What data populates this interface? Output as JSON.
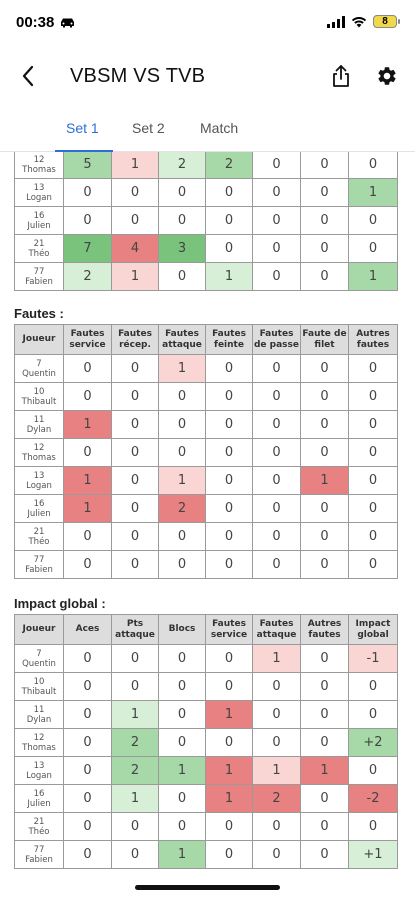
{
  "status_bar": {
    "time": "00:38",
    "battery": "8"
  },
  "header": {
    "title": "VBSM VS TVB"
  },
  "tabs": [
    {
      "label": "Set 1",
      "active": true
    },
    {
      "label": "Set 2",
      "active": false
    },
    {
      "label": "Match",
      "active": false
    }
  ],
  "colors": {
    "accent": "#2d6fd8",
    "green_dark": "#79c37d",
    "green_mid": "#a7d9a8",
    "green_light": "#d7efd6",
    "red_dark": "#e88282",
    "red_mid": "#f1a8a6",
    "red_light": "#f9d5d3",
    "header_bg": "#dddddd"
  },
  "top_table": {
    "rows": [
      {
        "num": "12",
        "name": "Thomas",
        "cells": [
          {
            "v": "5",
            "c": "g2"
          },
          {
            "v": "1",
            "c": "r1"
          },
          {
            "v": "2",
            "c": "g1"
          },
          {
            "v": "2",
            "c": "g2"
          },
          {
            "v": "0"
          },
          {
            "v": "0"
          },
          {
            "v": "0"
          }
        ]
      },
      {
        "num": "13",
        "name": "Logan",
        "cells": [
          {
            "v": "0"
          },
          {
            "v": "0"
          },
          {
            "v": "0"
          },
          {
            "v": "0"
          },
          {
            "v": "0"
          },
          {
            "v": "0"
          },
          {
            "v": "1",
            "c": "g2"
          }
        ]
      },
      {
        "num": "16",
        "name": "Julien",
        "cells": [
          {
            "v": "0"
          },
          {
            "v": "0"
          },
          {
            "v": "0"
          },
          {
            "v": "0"
          },
          {
            "v": "0"
          },
          {
            "v": "0"
          },
          {
            "v": "0"
          }
        ]
      },
      {
        "num": "21",
        "name": "Théo",
        "cells": [
          {
            "v": "7",
            "c": "g3"
          },
          {
            "v": "4",
            "c": "r3"
          },
          {
            "v": "3",
            "c": "g3"
          },
          {
            "v": "0"
          },
          {
            "v": "0"
          },
          {
            "v": "0"
          },
          {
            "v": "0"
          }
        ]
      },
      {
        "num": "77",
        "name": "Fabien",
        "cells": [
          {
            "v": "2",
            "c": "g1"
          },
          {
            "v": "1",
            "c": "r1"
          },
          {
            "v": "0"
          },
          {
            "v": "1",
            "c": "g1"
          },
          {
            "v": "0"
          },
          {
            "v": "0"
          },
          {
            "v": "1",
            "c": "g2"
          }
        ]
      }
    ]
  },
  "fautes": {
    "title": "Fautes :",
    "headers": [
      "Joueur",
      "Fautes service",
      "Fautes récep.",
      "Fautes attaque",
      "Fautes feinte",
      "Fautes de passe",
      "Faute de filet",
      "Autres fautes"
    ],
    "rows": [
      {
        "num": "7",
        "name": "Quentin",
        "cells": [
          {
            "v": "0"
          },
          {
            "v": "0"
          },
          {
            "v": "1",
            "c": "r1"
          },
          {
            "v": "0"
          },
          {
            "v": "0"
          },
          {
            "v": "0"
          },
          {
            "v": "0"
          }
        ]
      },
      {
        "num": "10",
        "name": "Thibault",
        "cells": [
          {
            "v": "0"
          },
          {
            "v": "0"
          },
          {
            "v": "0"
          },
          {
            "v": "0"
          },
          {
            "v": "0"
          },
          {
            "v": "0"
          },
          {
            "v": "0"
          }
        ]
      },
      {
        "num": "11",
        "name": "Dylan",
        "cells": [
          {
            "v": "1",
            "c": "r3"
          },
          {
            "v": "0"
          },
          {
            "v": "0"
          },
          {
            "v": "0"
          },
          {
            "v": "0"
          },
          {
            "v": "0"
          },
          {
            "v": "0"
          }
        ]
      },
      {
        "num": "12",
        "name": "Thomas",
        "cells": [
          {
            "v": "0"
          },
          {
            "v": "0"
          },
          {
            "v": "0"
          },
          {
            "v": "0"
          },
          {
            "v": "0"
          },
          {
            "v": "0"
          },
          {
            "v": "0"
          }
        ]
      },
      {
        "num": "13",
        "name": "Logan",
        "cells": [
          {
            "v": "1",
            "c": "r3"
          },
          {
            "v": "0"
          },
          {
            "v": "1",
            "c": "r1"
          },
          {
            "v": "0"
          },
          {
            "v": "0"
          },
          {
            "v": "1",
            "c": "r3"
          },
          {
            "v": "0"
          }
        ]
      },
      {
        "num": "16",
        "name": "Julien",
        "cells": [
          {
            "v": "1",
            "c": "r3"
          },
          {
            "v": "0"
          },
          {
            "v": "2",
            "c": "r3"
          },
          {
            "v": "0"
          },
          {
            "v": "0"
          },
          {
            "v": "0"
          },
          {
            "v": "0"
          }
        ]
      },
      {
        "num": "21",
        "name": "Théo",
        "cells": [
          {
            "v": "0"
          },
          {
            "v": "0"
          },
          {
            "v": "0"
          },
          {
            "v": "0"
          },
          {
            "v": "0"
          },
          {
            "v": "0"
          },
          {
            "v": "0"
          }
        ]
      },
      {
        "num": "77",
        "name": "Fabien",
        "cells": [
          {
            "v": "0"
          },
          {
            "v": "0"
          },
          {
            "v": "0"
          },
          {
            "v": "0"
          },
          {
            "v": "0"
          },
          {
            "v": "0"
          },
          {
            "v": "0"
          }
        ]
      }
    ]
  },
  "impact": {
    "title": "Impact global :",
    "headers": [
      "Joueur",
      "Aces",
      "Pts attaque",
      "Blocs",
      "Fautes service",
      "Fautes attaque",
      "Autres fautes",
      "Impact global"
    ],
    "rows": [
      {
        "num": "7",
        "name": "Quentin",
        "cells": [
          {
            "v": "0"
          },
          {
            "v": "0"
          },
          {
            "v": "0"
          },
          {
            "v": "0"
          },
          {
            "v": "1",
            "c": "r1"
          },
          {
            "v": "0"
          },
          {
            "v": "-1",
            "c": "r1"
          }
        ]
      },
      {
        "num": "10",
        "name": "Thibault",
        "cells": [
          {
            "v": "0"
          },
          {
            "v": "0"
          },
          {
            "v": "0"
          },
          {
            "v": "0"
          },
          {
            "v": "0"
          },
          {
            "v": "0"
          },
          {
            "v": "0"
          }
        ]
      },
      {
        "num": "11",
        "name": "Dylan",
        "cells": [
          {
            "v": "0"
          },
          {
            "v": "1",
            "c": "g1"
          },
          {
            "v": "0"
          },
          {
            "v": "1",
            "c": "r3"
          },
          {
            "v": "0"
          },
          {
            "v": "0"
          },
          {
            "v": "0"
          }
        ]
      },
      {
        "num": "12",
        "name": "Thomas",
        "cells": [
          {
            "v": "0"
          },
          {
            "v": "2",
            "c": "g2"
          },
          {
            "v": "0"
          },
          {
            "v": "0"
          },
          {
            "v": "0"
          },
          {
            "v": "0"
          },
          {
            "v": "+2",
            "c": "g2"
          }
        ]
      },
      {
        "num": "13",
        "name": "Logan",
        "cells": [
          {
            "v": "0"
          },
          {
            "v": "2",
            "c": "g2"
          },
          {
            "v": "1",
            "c": "g2"
          },
          {
            "v": "1",
            "c": "r3"
          },
          {
            "v": "1",
            "c": "r1"
          },
          {
            "v": "1",
            "c": "r3"
          },
          {
            "v": "0"
          }
        ]
      },
      {
        "num": "16",
        "name": "Julien",
        "cells": [
          {
            "v": "0"
          },
          {
            "v": "1",
            "c": "g1"
          },
          {
            "v": "0"
          },
          {
            "v": "1",
            "c": "r3"
          },
          {
            "v": "2",
            "c": "r3"
          },
          {
            "v": "0"
          },
          {
            "v": "-2",
            "c": "r3"
          }
        ]
      },
      {
        "num": "21",
        "name": "Théo",
        "cells": [
          {
            "v": "0"
          },
          {
            "v": "0"
          },
          {
            "v": "0"
          },
          {
            "v": "0"
          },
          {
            "v": "0"
          },
          {
            "v": "0"
          },
          {
            "v": "0"
          }
        ]
      },
      {
        "num": "77",
        "name": "Fabien",
        "cells": [
          {
            "v": "0"
          },
          {
            "v": "0"
          },
          {
            "v": "1",
            "c": "g2"
          },
          {
            "v": "0"
          },
          {
            "v": "0"
          },
          {
            "v": "0"
          },
          {
            "v": "+1",
            "c": "g1"
          }
        ]
      }
    ]
  }
}
